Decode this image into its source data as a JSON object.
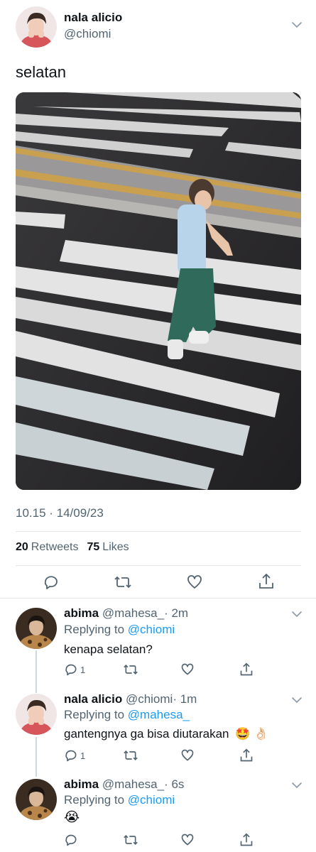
{
  "tweet": {
    "author_name": "nala alicio",
    "author_handle": "@chiomi",
    "text": "selatan",
    "timestamp": "10.15 · 14/09/23",
    "retweets_count": "20",
    "retweets_label": "Retweets",
    "likes_count": "75",
    "likes_label": "Likes"
  },
  "replies": [
    {
      "name": "abima",
      "handle": "@mahesa_",
      "time": "· 2m",
      "replying_prefix": "Replying to",
      "replying_to": "@chiomi",
      "text": "kenapa selatan?",
      "reply_count": "1"
    },
    {
      "name": "nala alicio",
      "handle": "@chiomi",
      "time": "· 1m",
      "replying_prefix": "Replying to",
      "replying_to": "@mahesa_",
      "text": "gantengnya ga bisa diutarakan",
      "emoji": "🤩 👌🏻",
      "reply_count": "1"
    },
    {
      "name": "abima",
      "handle": "@mahesa_",
      "time": "· 6s",
      "replying_prefix": "Replying to",
      "replying_to": "@chiomi",
      "emoji": "😭"
    }
  ],
  "icons": {
    "reply": "reply-icon",
    "retweet": "retweet-icon",
    "like": "like-icon",
    "share": "share-icon",
    "more": "chevron-down-icon"
  },
  "colors": {
    "link": "#1d9bf0",
    "muted": "#536471",
    "divider": "#e1e4e8"
  }
}
